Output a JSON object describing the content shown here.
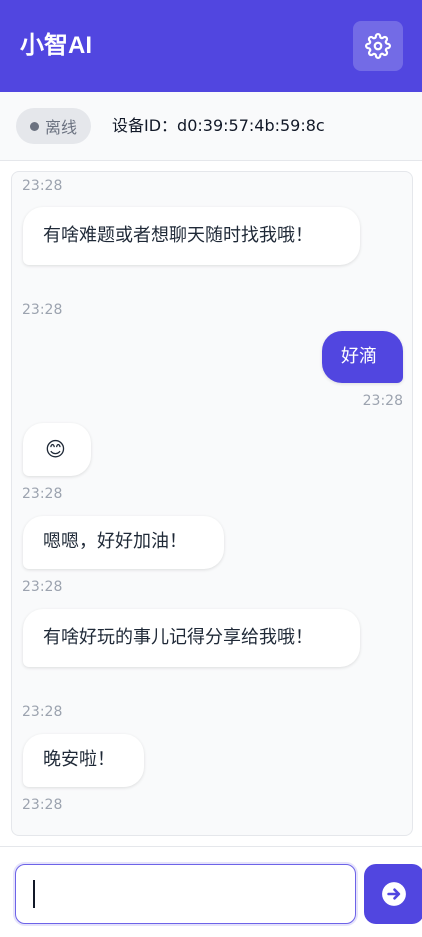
{
  "header": {
    "title": "小智AI",
    "settings_icon": "gear-icon"
  },
  "status": {
    "connection": "离线",
    "device_id_text": "设备ID：d0:39:57:4b:59:8c"
  },
  "messages": [
    {
      "role": "ai",
      "time": "23:28",
      "text": ""
    },
    {
      "role": "ai",
      "time": "23:28",
      "text": "有啥难题或者想聊天随时找我哦！"
    },
    {
      "role": "user",
      "time": "23:28",
      "text": "好滴"
    },
    {
      "role": "ai",
      "time": "23:28",
      "text": "😊"
    },
    {
      "role": "ai",
      "time": "23:28",
      "text": "嗯嗯，好好加油！"
    },
    {
      "role": "ai",
      "time": "23:28",
      "text": "有啥好玩的事儿记得分享给我哦！"
    },
    {
      "role": "ai",
      "time": "23:28",
      "text": "晚安啦！"
    }
  ],
  "composer": {
    "value": "",
    "placeholder": "",
    "send_icon": "arrow-right-circle-icon"
  },
  "colors": {
    "brand": "#5146e0",
    "offline": "#6b7280"
  }
}
